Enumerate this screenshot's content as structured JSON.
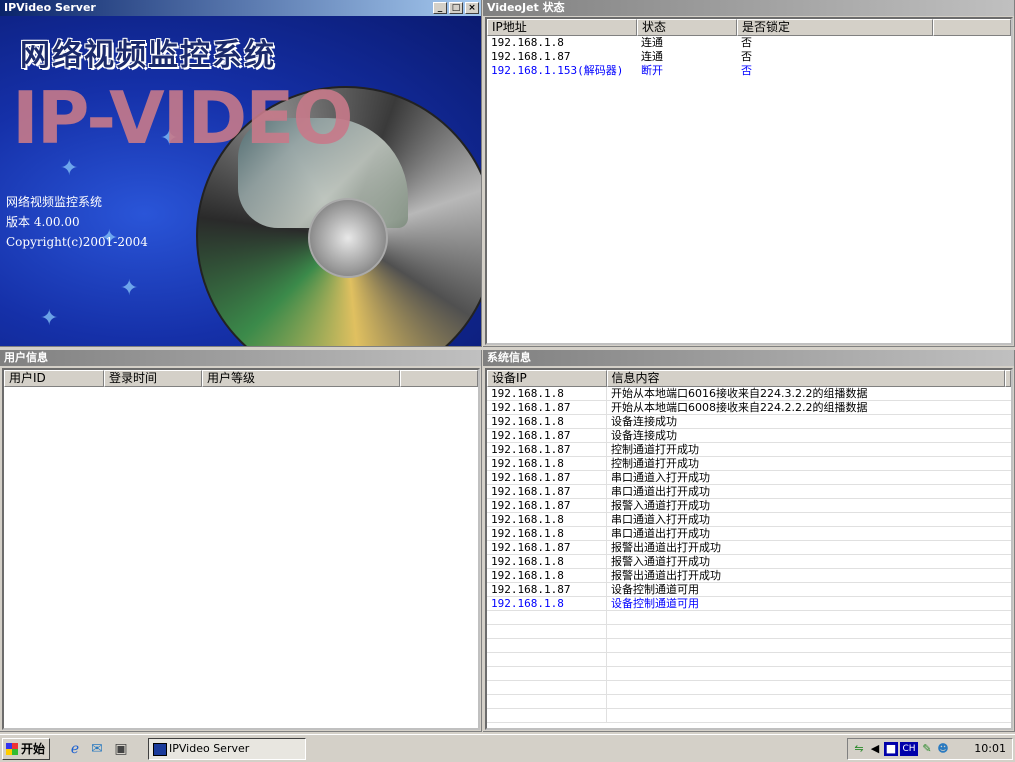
{
  "main_window": {
    "title": "IPVideo Server",
    "controls": {
      "minimize": "_",
      "maximize": "□",
      "close": "×"
    }
  },
  "splash": {
    "heading": "网络视频监控系统",
    "logo": "IP-VIDEO",
    "product_name": "网络视频监控系统",
    "version": "版本 4.00.00",
    "copyright": "Copyright(c)2001-2004"
  },
  "videojet_panel": {
    "title": "VideoJet 状态",
    "columns": [
      "IP地址",
      "状态",
      "是否锁定"
    ],
    "rows": [
      {
        "ip": "192.168.1.8",
        "status": "连通",
        "locked": "否"
      },
      {
        "ip": "192.168.1.87",
        "status": "连通",
        "locked": "否"
      },
      {
        "ip": "192.168.1.153(解码器)",
        "status": "断开",
        "locked": "否"
      }
    ]
  },
  "user_panel": {
    "title": "用户信息",
    "columns": [
      "用户ID",
      "登录时间",
      "用户等级"
    ]
  },
  "system_panel": {
    "title": "系统信息",
    "columns": [
      "设备IP",
      "信息内容"
    ],
    "rows": [
      {
        "ip": "192.168.1.8",
        "msg": "开始从本地端口6016接收来自224.3.2.2的组播数据"
      },
      {
        "ip": "192.168.1.87",
        "msg": "开始从本地端口6008接收来自224.2.2.2的组播数据"
      },
      {
        "ip": "192.168.1.8",
        "msg": "设备连接成功"
      },
      {
        "ip": "192.168.1.87",
        "msg": "设备连接成功"
      },
      {
        "ip": "192.168.1.87",
        "msg": "控制通道打开成功"
      },
      {
        "ip": "192.168.1.8",
        "msg": "控制通道打开成功"
      },
      {
        "ip": "192.168.1.87",
        "msg": "串口通道入打开成功"
      },
      {
        "ip": "192.168.1.87",
        "msg": "串口通道出打开成功"
      },
      {
        "ip": "192.168.1.87",
        "msg": "报警入通道打开成功"
      },
      {
        "ip": "192.168.1.8",
        "msg": "串口通道入打开成功"
      },
      {
        "ip": "192.168.1.8",
        "msg": "串口通道出打开成功"
      },
      {
        "ip": "192.168.1.87",
        "msg": "报警出通道出打开成功"
      },
      {
        "ip": "192.168.1.8",
        "msg": "报警入通道打开成功"
      },
      {
        "ip": "192.168.1.8",
        "msg": "报警出通道出打开成功"
      },
      {
        "ip": "192.168.1.87",
        "msg": "设备控制通道可用"
      },
      {
        "ip": "192.168.1.8",
        "msg": "设备控制通道可用"
      }
    ]
  },
  "taskbar": {
    "start_label": "开始",
    "task_label": "IPVideo Server",
    "tray_lang": "CH",
    "clock": "10:01"
  },
  "colors": {
    "active_title": "#0a246a",
    "inactive_title": "#808080",
    "highlight_text": "#0000ff",
    "splash_bg": "#1530a8"
  }
}
